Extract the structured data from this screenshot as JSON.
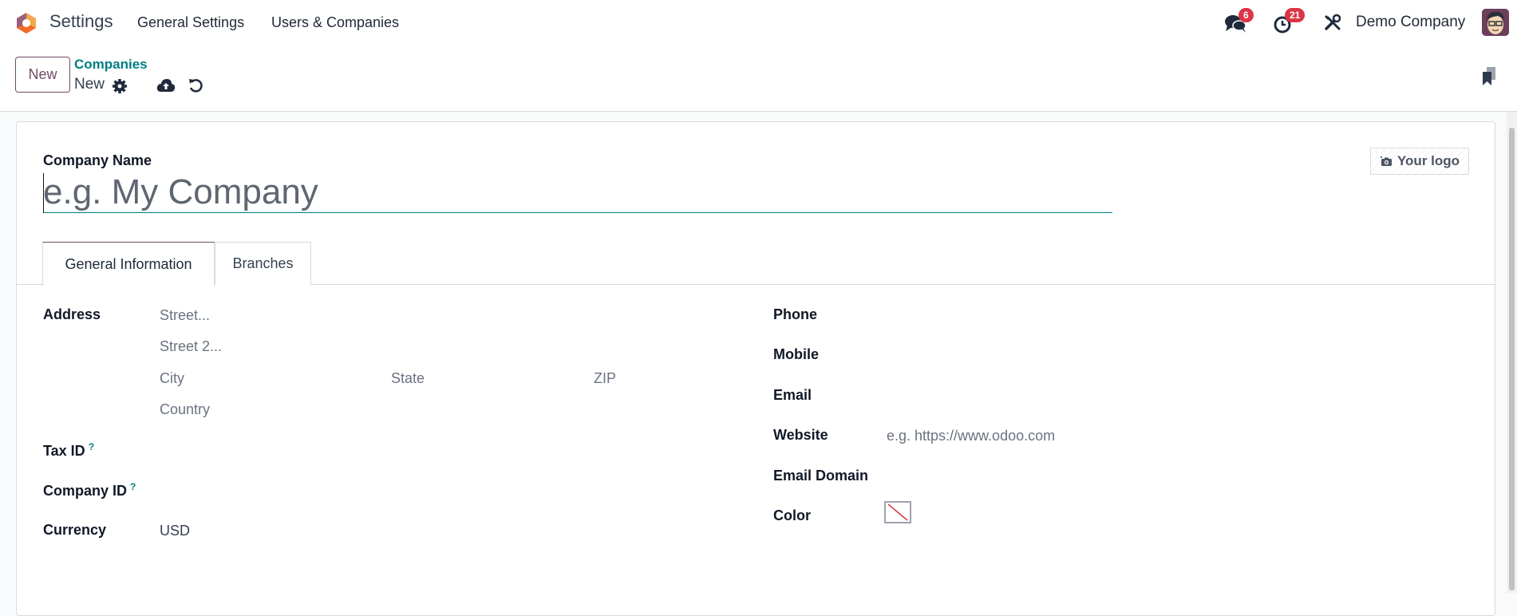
{
  "topnav": {
    "app_title": "Settings",
    "menu": [
      "General Settings",
      "Users & Companies"
    ],
    "messages_count": "6",
    "activities_count": "21",
    "company": "Demo Company"
  },
  "control": {
    "new_button": "New",
    "breadcrumb_parent": "Companies",
    "breadcrumb_current": "New"
  },
  "form": {
    "company_name_label": "Company Name",
    "company_name_placeholder": "e.g. My Company",
    "logo_button": "Your logo",
    "tabs": [
      "General Information",
      "Branches"
    ],
    "address": {
      "label": "Address",
      "street": "Street...",
      "street2": "Street 2...",
      "city": "City",
      "state": "State",
      "zip": "ZIP",
      "country": "Country"
    },
    "tax_id_label": "Tax ID",
    "company_id_label": "Company ID",
    "help_mark": "?",
    "currency_label": "Currency",
    "currency_value": "USD",
    "phone_label": "Phone",
    "mobile_label": "Mobile",
    "email_label": "Email",
    "website_label": "Website",
    "website_placeholder": "e.g. https://www.odoo.com",
    "email_domain_label": "Email Domain",
    "color_label": "Color"
  },
  "colors": {
    "brand": "#714b67",
    "link": "#017e84",
    "badge": "#dc3545"
  }
}
